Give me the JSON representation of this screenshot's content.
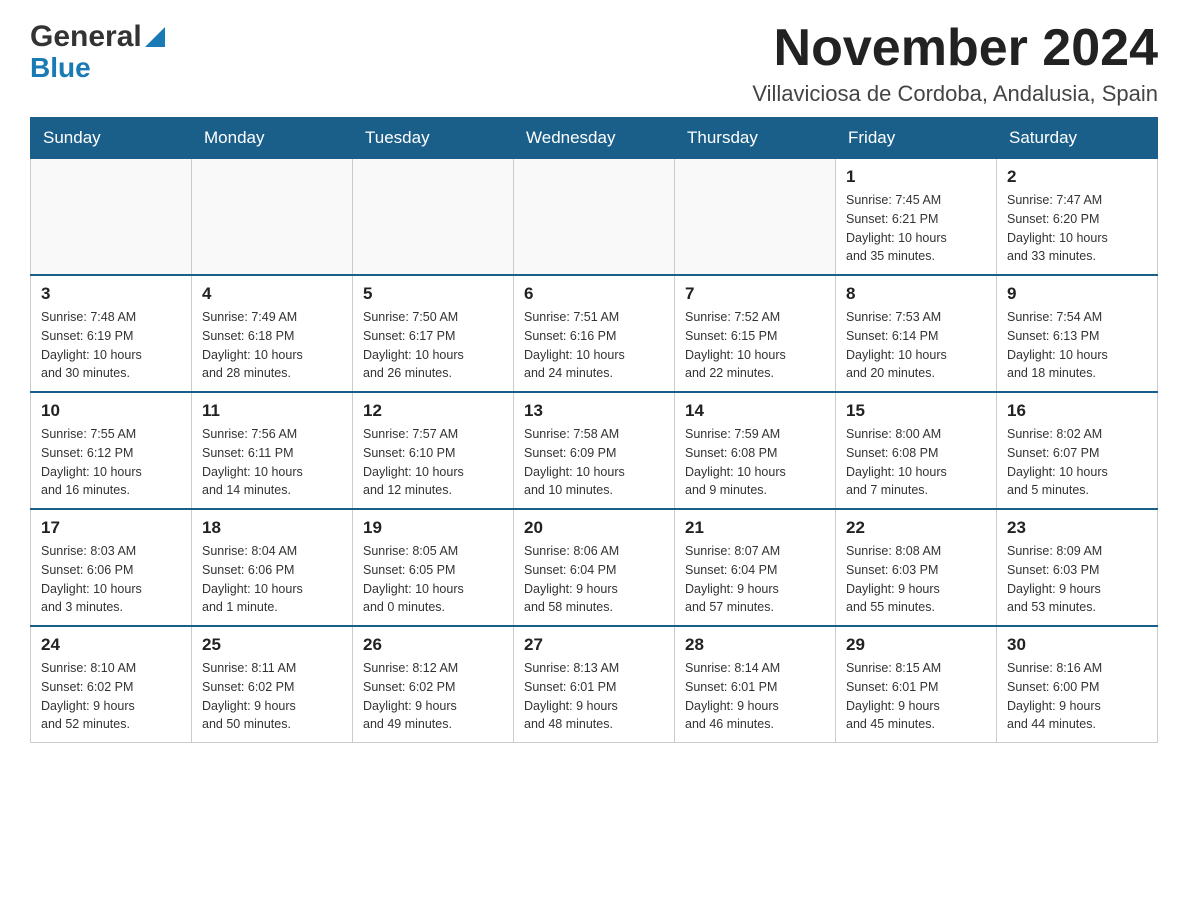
{
  "logo": {
    "general": "General",
    "blue": "Blue",
    "triangle_alt": "triangle"
  },
  "header": {
    "month": "November 2024",
    "location": "Villaviciosa de Cordoba, Andalusia, Spain"
  },
  "weekdays": [
    "Sunday",
    "Monday",
    "Tuesday",
    "Wednesday",
    "Thursday",
    "Friday",
    "Saturday"
  ],
  "weeks": [
    {
      "days": [
        {
          "num": "",
          "info": ""
        },
        {
          "num": "",
          "info": ""
        },
        {
          "num": "",
          "info": ""
        },
        {
          "num": "",
          "info": ""
        },
        {
          "num": "",
          "info": ""
        },
        {
          "num": "1",
          "info": "Sunrise: 7:45 AM\nSunset: 6:21 PM\nDaylight: 10 hours\nand 35 minutes."
        },
        {
          "num": "2",
          "info": "Sunrise: 7:47 AM\nSunset: 6:20 PM\nDaylight: 10 hours\nand 33 minutes."
        }
      ]
    },
    {
      "days": [
        {
          "num": "3",
          "info": "Sunrise: 7:48 AM\nSunset: 6:19 PM\nDaylight: 10 hours\nand 30 minutes."
        },
        {
          "num": "4",
          "info": "Sunrise: 7:49 AM\nSunset: 6:18 PM\nDaylight: 10 hours\nand 28 minutes."
        },
        {
          "num": "5",
          "info": "Sunrise: 7:50 AM\nSunset: 6:17 PM\nDaylight: 10 hours\nand 26 minutes."
        },
        {
          "num": "6",
          "info": "Sunrise: 7:51 AM\nSunset: 6:16 PM\nDaylight: 10 hours\nand 24 minutes."
        },
        {
          "num": "7",
          "info": "Sunrise: 7:52 AM\nSunset: 6:15 PM\nDaylight: 10 hours\nand 22 minutes."
        },
        {
          "num": "8",
          "info": "Sunrise: 7:53 AM\nSunset: 6:14 PM\nDaylight: 10 hours\nand 20 minutes."
        },
        {
          "num": "9",
          "info": "Sunrise: 7:54 AM\nSunset: 6:13 PM\nDaylight: 10 hours\nand 18 minutes."
        }
      ]
    },
    {
      "days": [
        {
          "num": "10",
          "info": "Sunrise: 7:55 AM\nSunset: 6:12 PM\nDaylight: 10 hours\nand 16 minutes."
        },
        {
          "num": "11",
          "info": "Sunrise: 7:56 AM\nSunset: 6:11 PM\nDaylight: 10 hours\nand 14 minutes."
        },
        {
          "num": "12",
          "info": "Sunrise: 7:57 AM\nSunset: 6:10 PM\nDaylight: 10 hours\nand 12 minutes."
        },
        {
          "num": "13",
          "info": "Sunrise: 7:58 AM\nSunset: 6:09 PM\nDaylight: 10 hours\nand 10 minutes."
        },
        {
          "num": "14",
          "info": "Sunrise: 7:59 AM\nSunset: 6:08 PM\nDaylight: 10 hours\nand 9 minutes."
        },
        {
          "num": "15",
          "info": "Sunrise: 8:00 AM\nSunset: 6:08 PM\nDaylight: 10 hours\nand 7 minutes."
        },
        {
          "num": "16",
          "info": "Sunrise: 8:02 AM\nSunset: 6:07 PM\nDaylight: 10 hours\nand 5 minutes."
        }
      ]
    },
    {
      "days": [
        {
          "num": "17",
          "info": "Sunrise: 8:03 AM\nSunset: 6:06 PM\nDaylight: 10 hours\nand 3 minutes."
        },
        {
          "num": "18",
          "info": "Sunrise: 8:04 AM\nSunset: 6:06 PM\nDaylight: 10 hours\nand 1 minute."
        },
        {
          "num": "19",
          "info": "Sunrise: 8:05 AM\nSunset: 6:05 PM\nDaylight: 10 hours\nand 0 minutes."
        },
        {
          "num": "20",
          "info": "Sunrise: 8:06 AM\nSunset: 6:04 PM\nDaylight: 9 hours\nand 58 minutes."
        },
        {
          "num": "21",
          "info": "Sunrise: 8:07 AM\nSunset: 6:04 PM\nDaylight: 9 hours\nand 57 minutes."
        },
        {
          "num": "22",
          "info": "Sunrise: 8:08 AM\nSunset: 6:03 PM\nDaylight: 9 hours\nand 55 minutes."
        },
        {
          "num": "23",
          "info": "Sunrise: 8:09 AM\nSunset: 6:03 PM\nDaylight: 9 hours\nand 53 minutes."
        }
      ]
    },
    {
      "days": [
        {
          "num": "24",
          "info": "Sunrise: 8:10 AM\nSunset: 6:02 PM\nDaylight: 9 hours\nand 52 minutes."
        },
        {
          "num": "25",
          "info": "Sunrise: 8:11 AM\nSunset: 6:02 PM\nDaylight: 9 hours\nand 50 minutes."
        },
        {
          "num": "26",
          "info": "Sunrise: 8:12 AM\nSunset: 6:02 PM\nDaylight: 9 hours\nand 49 minutes."
        },
        {
          "num": "27",
          "info": "Sunrise: 8:13 AM\nSunset: 6:01 PM\nDaylight: 9 hours\nand 48 minutes."
        },
        {
          "num": "28",
          "info": "Sunrise: 8:14 AM\nSunset: 6:01 PM\nDaylight: 9 hours\nand 46 minutes."
        },
        {
          "num": "29",
          "info": "Sunrise: 8:15 AM\nSunset: 6:01 PM\nDaylight: 9 hours\nand 45 minutes."
        },
        {
          "num": "30",
          "info": "Sunrise: 8:16 AM\nSunset: 6:00 PM\nDaylight: 9 hours\nand 44 minutes."
        }
      ]
    }
  ]
}
